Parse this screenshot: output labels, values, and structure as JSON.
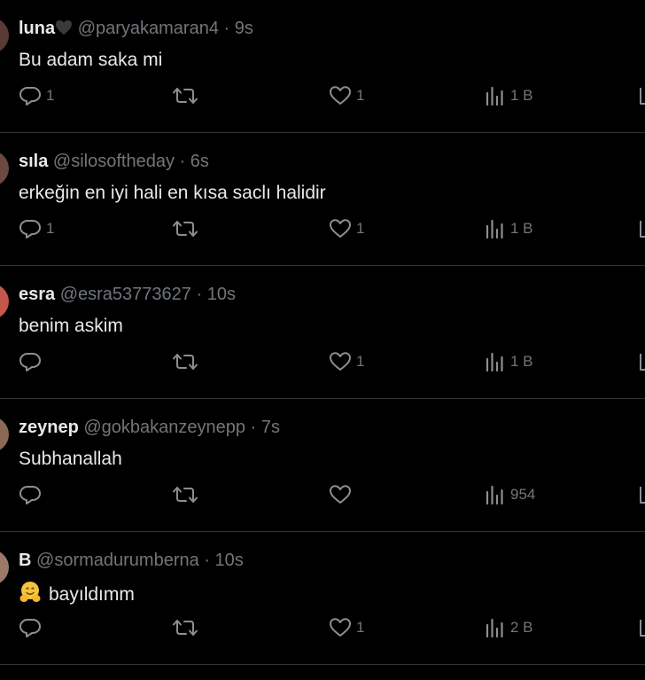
{
  "tweets": [
    {
      "name": "luna",
      "name_suffix_icon": "black-heart-icon",
      "handle": "@paryakamaran4",
      "time": "9s",
      "text": "Bu adam saka mi",
      "replies": "1",
      "likes": "1",
      "views": "1 B",
      "avatar_color": "#5a3a34"
    },
    {
      "name": "sıla",
      "handle": "@silosoftheday",
      "time": "6s",
      "text": "erkeğin en iyi hali en kısa saclı halidir",
      "replies": "1",
      "likes": "1",
      "views": "1 B",
      "avatar_color": "#6b4a42"
    },
    {
      "name": "esra",
      "handle": "@esra53773627",
      "time": "10s",
      "text": "benim askim",
      "replies": "",
      "likes": "1",
      "views": "1 B",
      "avatar_color": "#c4574a"
    },
    {
      "name": "zeynep",
      "handle": "@gokbakanzeynepp",
      "time": "7s",
      "text": "Subhanallah",
      "replies": "",
      "likes": "",
      "views": "954",
      "avatar_color": "#8a6a55"
    },
    {
      "name": "B",
      "handle": "@sormadurumberna",
      "time": "10s",
      "emoji_icon": "hugging-face-icon",
      "text": "bayıldımm",
      "replies": "",
      "likes": "1",
      "views": "2 B",
      "avatar_color": "#9a7a66"
    }
  ],
  "separator": "·",
  "colors": {
    "background": "#000000",
    "primary_text": "#e7e9ea",
    "secondary_text": "#71767b",
    "divider": "#2f3336"
  }
}
